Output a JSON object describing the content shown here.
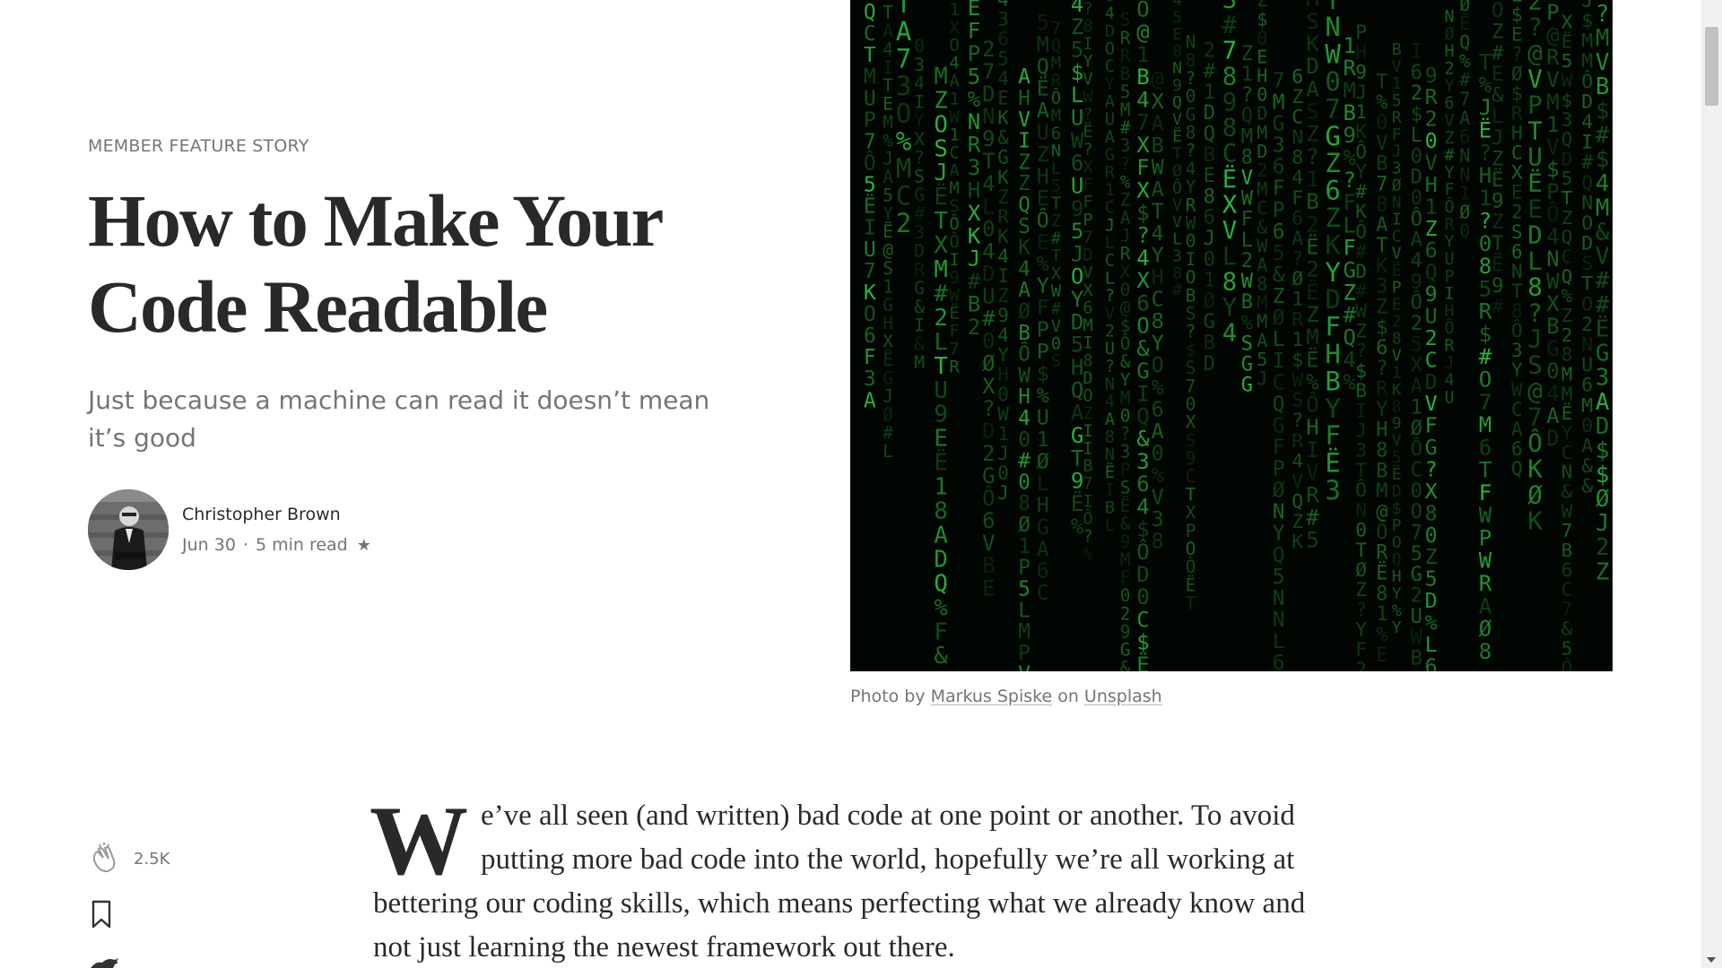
{
  "story": {
    "kicker": "MEMBER FEATURE STORY",
    "title_line1": "How to Make Your",
    "title_line2": "Code Readable",
    "subtitle": "Just because a machine can read it doesn’t mean it’s good"
  },
  "author": {
    "name": "Christopher Brown",
    "date": "Jun 30",
    "separator": "·",
    "read_time": "5 min read",
    "star": "★"
  },
  "image": {
    "caption_prefix": "Photo by ",
    "photographer": "Markus Spiske",
    "caption_mid": " on ",
    "source": "Unsplash",
    "icon": "matrix-code-photo"
  },
  "social": {
    "clap_count": "2.5K",
    "icons": [
      "clap-icon",
      "bookmark-icon",
      "twitter-icon"
    ]
  },
  "article": {
    "dropcap": "W",
    "first_paragraph": "e’ve all seen (and written) bad code at one point or another. To avoid putting more bad code into the world, hopefully we’re all working at bettering our coding skills, which means perfecting what we already know and not just learning the newest framework out there."
  },
  "colors": {
    "text": "#292929",
    "muted": "#757575",
    "matrix_green": "#2fbf45",
    "image_bg": "#020602"
  }
}
